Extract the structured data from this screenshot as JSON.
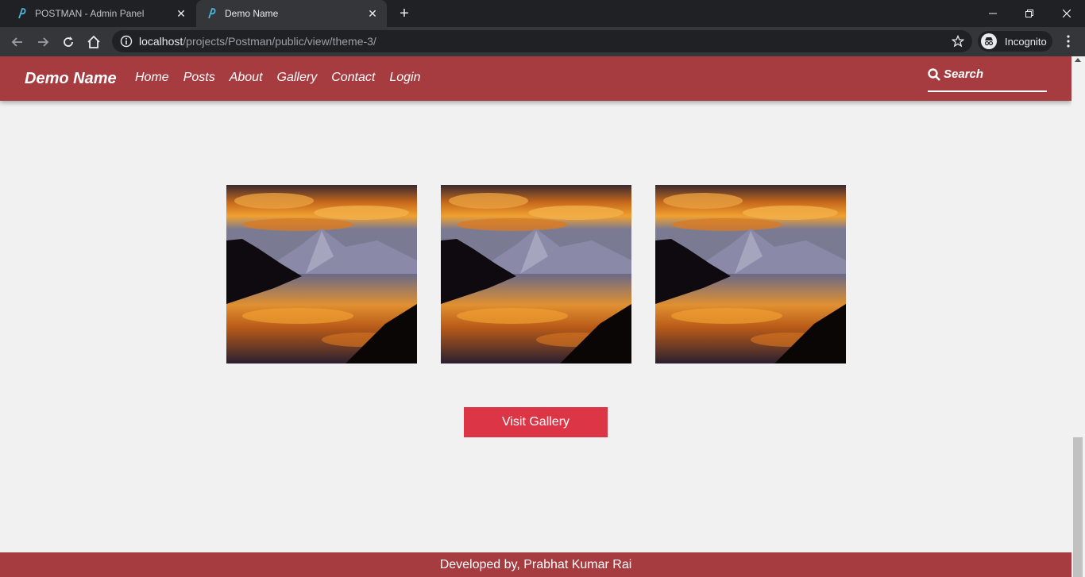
{
  "browser": {
    "tabs": [
      {
        "title": "POSTMAN - Admin Panel",
        "active": false
      },
      {
        "title": "Demo Name",
        "active": true
      }
    ],
    "address": {
      "host": "localhost",
      "path": "/projects/Postman/public/view/theme-3/"
    },
    "profile_label": "Incognito"
  },
  "site": {
    "brand": "Demo Name",
    "nav": [
      "Home",
      "Posts",
      "About",
      "Gallery",
      "Contact",
      "Login"
    ],
    "search_placeholder": "Search",
    "gallery_images": [
      {
        "alt": "mountain-sunset-reflection"
      },
      {
        "alt": "mountain-sunset-reflection"
      },
      {
        "alt": "mountain-sunset-reflection"
      }
    ],
    "visit_button": "Visit Gallery",
    "footer": "Developed by, Prabhat Kumar Rai"
  },
  "colors": {
    "navbar": "#a63c3f",
    "button": "#dc3545",
    "page_bg": "#f1f1f1"
  }
}
